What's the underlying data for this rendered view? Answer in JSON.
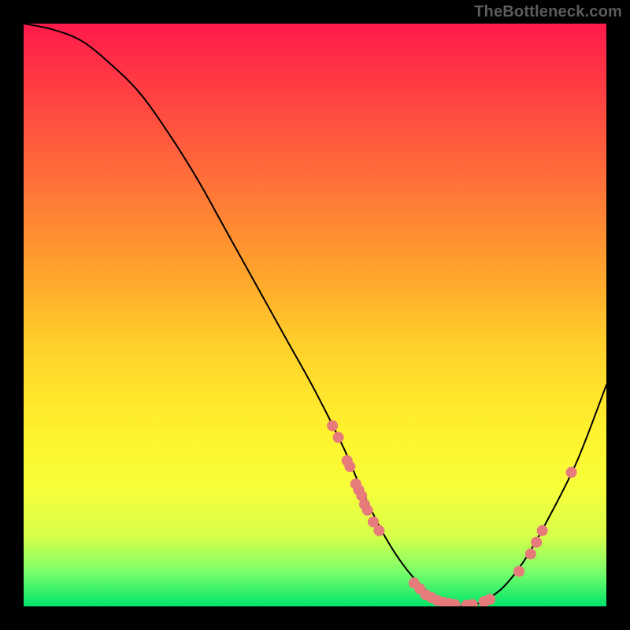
{
  "attribution": "TheBottleneck.com",
  "chart_data": {
    "type": "line",
    "title": "",
    "xlabel": "",
    "ylabel": "",
    "xlim": [
      0,
      100
    ],
    "ylim": [
      0,
      100
    ],
    "series": [
      {
        "name": "curve",
        "x": [
          0,
          5,
          10,
          15,
          20,
          25,
          30,
          35,
          40,
          45,
          50,
          55,
          58,
          62,
          66,
          70,
          73,
          75,
          78,
          82,
          86,
          90,
          95,
          100
        ],
        "y": [
          100,
          99,
          97,
          93,
          88,
          81,
          73,
          64,
          55,
          46,
          37,
          27,
          20,
          12,
          6,
          2,
          0.5,
          0,
          0.5,
          3,
          8,
          15,
          25,
          38
        ]
      }
    ],
    "markers": [
      {
        "x": 53,
        "y": 31
      },
      {
        "x": 54,
        "y": 29
      },
      {
        "x": 55.5,
        "y": 25
      },
      {
        "x": 56,
        "y": 24
      },
      {
        "x": 57,
        "y": 21
      },
      {
        "x": 57.5,
        "y": 20
      },
      {
        "x": 58,
        "y": 19
      },
      {
        "x": 58.5,
        "y": 17.5
      },
      {
        "x": 59,
        "y": 16.5
      },
      {
        "x": 60,
        "y": 14.5
      },
      {
        "x": 61,
        "y": 13
      },
      {
        "x": 67,
        "y": 4
      },
      {
        "x": 68,
        "y": 3
      },
      {
        "x": 69,
        "y": 2
      },
      {
        "x": 70,
        "y": 1.5
      },
      {
        "x": 71,
        "y": 1
      },
      {
        "x": 72,
        "y": 0.7
      },
      {
        "x": 73,
        "y": 0.5
      },
      {
        "x": 74,
        "y": 0.3
      },
      {
        "x": 76,
        "y": 0.2
      },
      {
        "x": 77,
        "y": 0.3
      },
      {
        "x": 79,
        "y": 0.8
      },
      {
        "x": 80,
        "y": 1.2
      },
      {
        "x": 85,
        "y": 6
      },
      {
        "x": 87,
        "y": 9
      },
      {
        "x": 88,
        "y": 11
      },
      {
        "x": 89,
        "y": 13
      },
      {
        "x": 94,
        "y": 23
      }
    ],
    "marker_color": "#e77a7a",
    "marker_radius": 7
  }
}
